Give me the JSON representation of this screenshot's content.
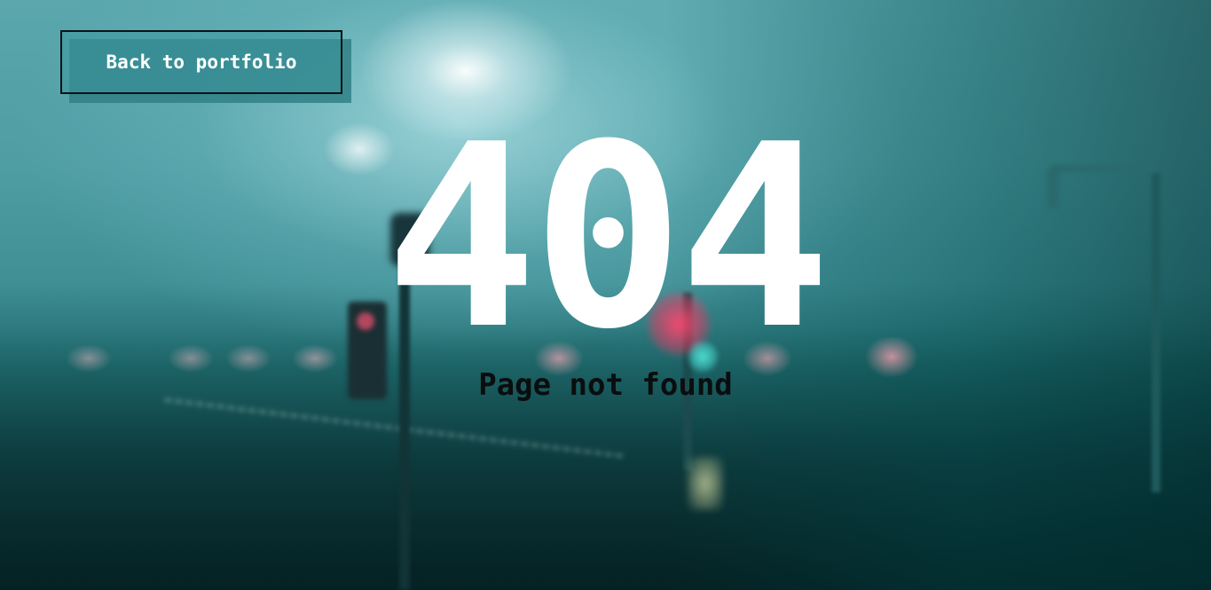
{
  "back_button": {
    "label": "Back to portfolio"
  },
  "error": {
    "code": "404",
    "message": "Page not found"
  },
  "colors": {
    "background_teal": "#3f8f95",
    "text_primary": "#ffffff",
    "text_secondary": "#0a0d0e",
    "button_border": "#0a1416",
    "button_shadow": "#308086"
  },
  "background_image": "foggy street at night with traffic lights (blurred)"
}
